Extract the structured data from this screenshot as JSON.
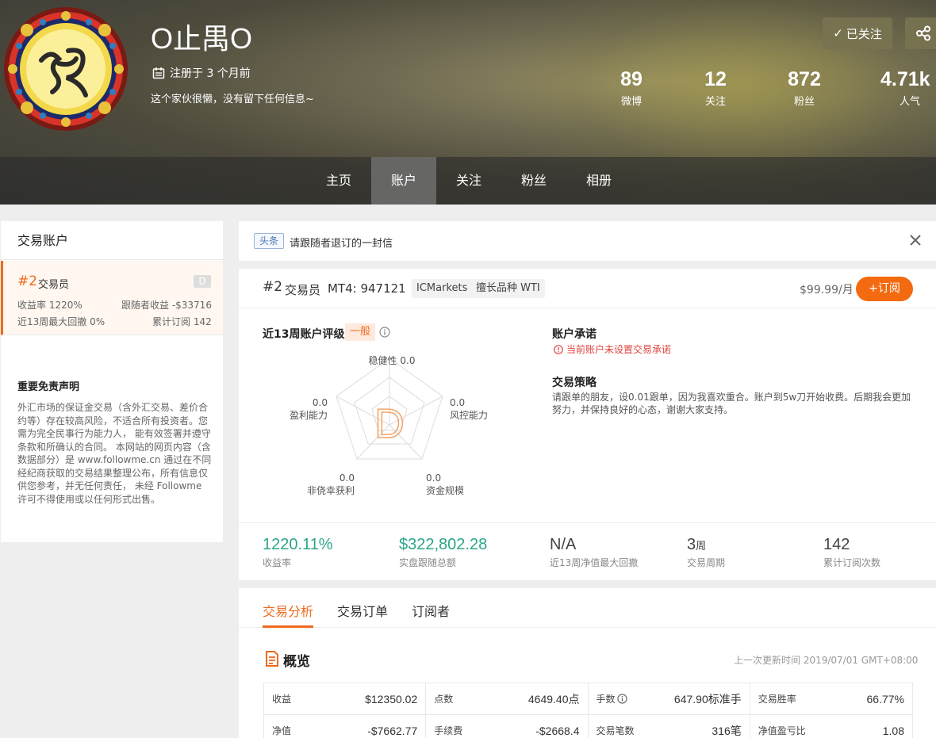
{
  "profile": {
    "username": "O止禺O",
    "registered": "注册于 3 个月前",
    "bio": "这个家伙很懒，没有留下任何信息~",
    "follow_label": "已关注"
  },
  "stats": [
    {
      "num": "89",
      "label": "微博"
    },
    {
      "num": "12",
      "label": "关注"
    },
    {
      "num": "872",
      "label": "粉丝"
    },
    {
      "num": "4.71k",
      "label": "人气"
    }
  ],
  "nav": [
    "主页",
    "账户",
    "关注",
    "粉丝",
    "相册"
  ],
  "sidebar": {
    "title": "交易账户",
    "account": {
      "rank": "#2",
      "role": "交易员",
      "badge": "D",
      "return_rate": "收益率 1220%",
      "follower_profit": "跟随者收益 -$33716",
      "max_drawdown": "近13周最大回撤 0%",
      "subscriptions": "累计订阅 142"
    },
    "disclaimer_title": "重要免责声明",
    "disclaimer_text": "外汇市场的保证金交易（含外汇交易、差价合约等）存在较高风险，不适合所有投资者。您需为完全民事行为能力人， 能有效签署并遵守条款和所确认的合同。 本网站的网页内容（含数据部分）是 www.followme.cn 通过在不同经纪商获取的交易结果整理公布，所有信息仅供您参考，并无任何责任， 未经 Followme 许可不得使用或以任何形式出售。"
  },
  "notice": {
    "tag": "头条",
    "text": "请跟随者退订的一封信"
  },
  "account_card": {
    "rank": "#2",
    "role": "交易员",
    "mt4": "MT4: 947121",
    "broker": "ICMarkets",
    "specialty": "擅长品种 WTI",
    "price": "$99.99/月",
    "subscribe_label": "订阅",
    "rating_title": "近13周账户评级",
    "rating_badge": "一般",
    "grade": "D",
    "radar": {
      "stability": {
        "label": "稳健性",
        "value": "0.0"
      },
      "risk_control": {
        "label": "风控能力",
        "value": "0.0"
      },
      "capital": {
        "label": "资金规模",
        "value": "0.0"
      },
      "non_luck": {
        "label": "非侥幸获利",
        "value": "0.0"
      },
      "profitability": {
        "label": "盈利能力",
        "value": "0.0"
      }
    },
    "promise_title": "账户承诺",
    "promise_warning": "当前账户未设置交易承诺",
    "strategy_title": "交易策略",
    "strategy_text": "请跟单的朋友，设0.01跟单，因为我喜欢重合。账户到5w刀开始收费。后期我会更加努力，并保持良好的心态，谢谢大家支持。",
    "metrics": [
      {
        "value": "1220.11%",
        "label": "收益率"
      },
      {
        "value": "$322,802.28",
        "label": "实盘跟随总额"
      },
      {
        "value": "N/A",
        "label": "近13周净值最大回撤"
      },
      {
        "value": "3",
        "unit": "周",
        "label": "交易周期"
      },
      {
        "value": "142",
        "label": "累计订阅次数"
      }
    ]
  },
  "tabs": [
    "交易分析",
    "交易订单",
    "订阅者"
  ],
  "overview": {
    "title": "概览",
    "updated": "上一次更新时间 2019/07/01 GMT+08:00",
    "rows": [
      [
        {
          "k": "收益",
          "v": "$12350.02"
        },
        {
          "k": "点数",
          "v": "4649.40点"
        },
        {
          "k": "手数",
          "v": "647.90标准手"
        },
        {
          "k": "交易胜率",
          "v": "66.77%"
        }
      ],
      [
        {
          "k": "净值",
          "v": "-$7662.77"
        },
        {
          "k": "手续费",
          "v": "-$2668.4"
        },
        {
          "k": "交易笔数",
          "v": "316笔"
        },
        {
          "k": "净值盈亏比",
          "v": "1.08"
        }
      ]
    ]
  },
  "colors": {
    "accent": "#f06a1e",
    "green": "#2aa58a",
    "warning": "#e0443e"
  }
}
